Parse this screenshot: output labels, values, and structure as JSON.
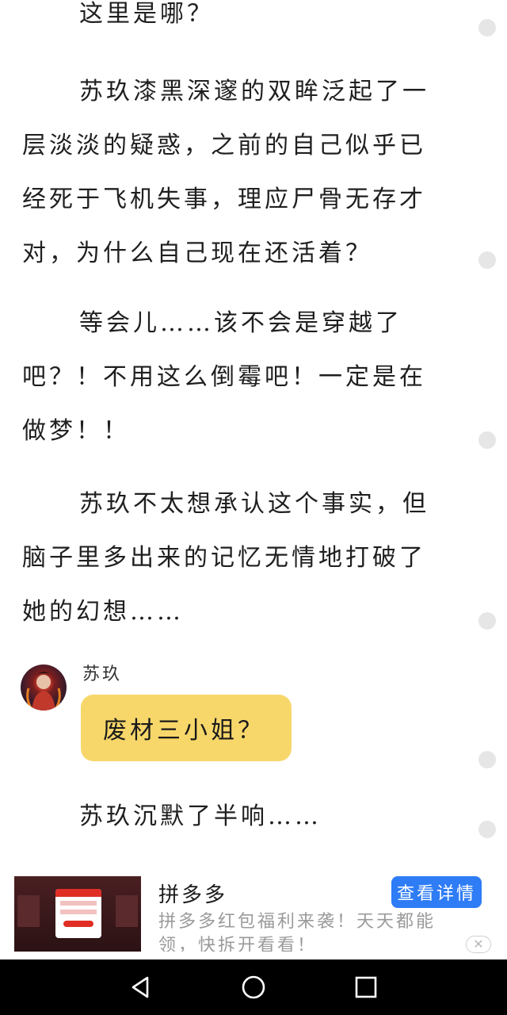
{
  "reader": {
    "paragraphs": [
      "这里是哪？",
      "苏玖漆黑深邃的双眸泛起了一层淡淡的疑惑，之前的自己似乎已经死于飞机失事，理应尸骨无存才对，为什么自己现在还活着？",
      "等会儿……该不会是穿越了吧？！不用这么倒霉吧！一定是在做梦！！",
      "苏玖不太想承认这个事实，但脑子里多出来的记忆无情地打破了她的幻想……",
      "苏玖沉默了半响……"
    ],
    "dialogue": {
      "speaker": "苏玖",
      "text": "废材三小姐？"
    }
  },
  "ad": {
    "title": "拼多多",
    "description": "拼多多红包福利来袭！天天都能领，快拆开看看！",
    "cta_label": "查看详情",
    "close_icon": "close-icon",
    "thumbnail_icon": "ad-thumbnail"
  },
  "navbar": {
    "back_icon": "back-icon",
    "home_icon": "home-icon",
    "recents_icon": "recents-icon"
  },
  "colors": {
    "bubble": "#f8d76a",
    "cta": "#2e7cf6",
    "navbar": "#000000"
  }
}
